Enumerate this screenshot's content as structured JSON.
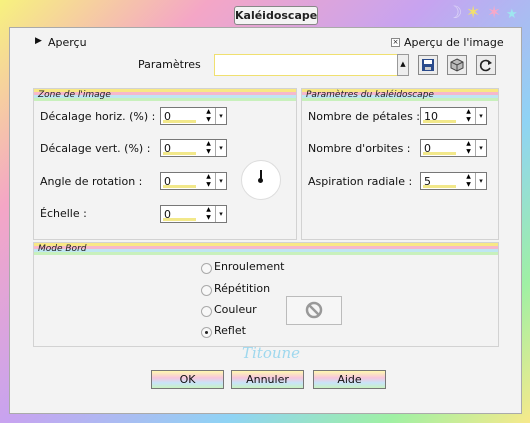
{
  "window": {
    "title": "Kaléidoscape"
  },
  "preview": {
    "toggle_label": "Aperçu",
    "checkbox_label": "Aperçu de l'image",
    "presets_label": "Paramètres",
    "presets_value": ""
  },
  "image_zone": {
    "title": "Zone de l'image",
    "fields": [
      {
        "label": "Décalage horiz. (%) :",
        "value": "0"
      },
      {
        "label": "Décalage vert. (%) :",
        "value": "0"
      },
      {
        "label": "Angle de rotation :",
        "value": "0"
      },
      {
        "label": "Échelle :",
        "value": "0"
      }
    ]
  },
  "kaleido_params": {
    "title": "Paramètres du kaléidoscape",
    "fields": [
      {
        "label": "Nombre de pétales :",
        "value": "10"
      },
      {
        "label": "Nombre d'orbites :",
        "value": "0"
      },
      {
        "label": "Aspiration radiale :",
        "value": "5"
      }
    ]
  },
  "edge_mode": {
    "title": "Mode Bord",
    "options": [
      {
        "label": "Enroulement",
        "selected": false
      },
      {
        "label": "Répétition",
        "selected": false
      },
      {
        "label": "Couleur",
        "selected": false
      },
      {
        "label": "Reflet",
        "selected": true
      }
    ]
  },
  "signature": "Titoune",
  "buttons": {
    "ok": "OK",
    "cancel": "Annuler",
    "help": "Aide"
  },
  "icons": {
    "expand": "triangle-right-icon",
    "save": "save-icon",
    "cube": "cube-icon",
    "reset": "reset-icon",
    "color_none": "no-color-icon",
    "moon": "moon-icon",
    "star": "star-icon"
  },
  "colors": {
    "frame_yellow": "#f7f27e",
    "frame_pink": "#f4a6c6",
    "frame_blue": "#8fd3f4",
    "frame_green": "#9ff0a4",
    "panel": "#f3f3f3"
  }
}
